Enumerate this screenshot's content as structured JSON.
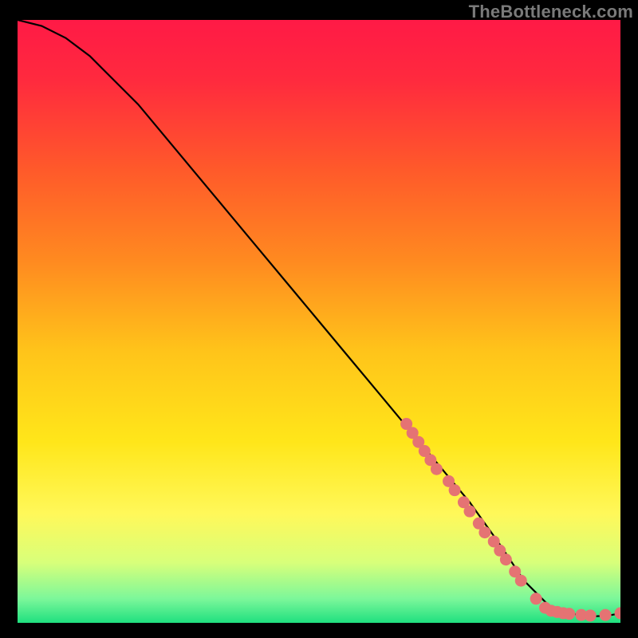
{
  "attribution": "TheBottleneck.com",
  "gradient": {
    "stops": [
      {
        "offset": 0.0,
        "color": "#ff1a46"
      },
      {
        "offset": 0.1,
        "color": "#ff2a3e"
      },
      {
        "offset": 0.25,
        "color": "#ff5a2a"
      },
      {
        "offset": 0.4,
        "color": "#ff8a20"
      },
      {
        "offset": 0.55,
        "color": "#ffc41a"
      },
      {
        "offset": 0.7,
        "color": "#ffe61a"
      },
      {
        "offset": 0.82,
        "color": "#fff85a"
      },
      {
        "offset": 0.9,
        "color": "#d8ff7a"
      },
      {
        "offset": 0.96,
        "color": "#7cf79a"
      },
      {
        "offset": 1.0,
        "color": "#1fe07f"
      }
    ]
  },
  "curve_color": "#000000",
  "marker_color": "#e57373",
  "chart_data": {
    "type": "line",
    "title": "",
    "xlabel": "",
    "ylabel": "",
    "xlim": [
      0,
      100
    ],
    "ylim": [
      0,
      100
    ],
    "series": [
      {
        "name": "curve",
        "x": [
          0,
          4,
          8,
          12,
          16,
          20,
          25,
          30,
          35,
          40,
          45,
          50,
          55,
          60,
          65,
          70,
          75,
          80,
          82,
          84,
          86,
          88,
          90,
          92,
          94,
          96,
          98,
          100
        ],
        "y": [
          100,
          99,
          97,
          94,
          90,
          86,
          80,
          74,
          68,
          62,
          56,
          50,
          44,
          38,
          32,
          26,
          20,
          13,
          10,
          7,
          5,
          3,
          2,
          1.5,
          1.2,
          1.1,
          1.2,
          1.6
        ]
      }
    ],
    "markers": [
      {
        "x": 64.5,
        "y": 33
      },
      {
        "x": 65.5,
        "y": 31.5
      },
      {
        "x": 66.5,
        "y": 30
      },
      {
        "x": 67.5,
        "y": 28.5
      },
      {
        "x": 68.5,
        "y": 27
      },
      {
        "x": 69.5,
        "y": 25.5
      },
      {
        "x": 71.5,
        "y": 23.5
      },
      {
        "x": 72.5,
        "y": 22
      },
      {
        "x": 74,
        "y": 20
      },
      {
        "x": 75,
        "y": 18.5
      },
      {
        "x": 76.5,
        "y": 16.5
      },
      {
        "x": 77.5,
        "y": 15
      },
      {
        "x": 79,
        "y": 13.5
      },
      {
        "x": 80,
        "y": 12
      },
      {
        "x": 81,
        "y": 10.5
      },
      {
        "x": 82.5,
        "y": 8.5
      },
      {
        "x": 83.5,
        "y": 7
      },
      {
        "x": 86,
        "y": 4
      },
      {
        "x": 87.5,
        "y": 2.5
      },
      {
        "x": 88.5,
        "y": 2
      },
      {
        "x": 89.5,
        "y": 1.8
      },
      {
        "x": 90.5,
        "y": 1.6
      },
      {
        "x": 91.5,
        "y": 1.5
      },
      {
        "x": 93.5,
        "y": 1.3
      },
      {
        "x": 95,
        "y": 1.2
      },
      {
        "x": 97.5,
        "y": 1.3
      },
      {
        "x": 100,
        "y": 1.6
      }
    ]
  }
}
